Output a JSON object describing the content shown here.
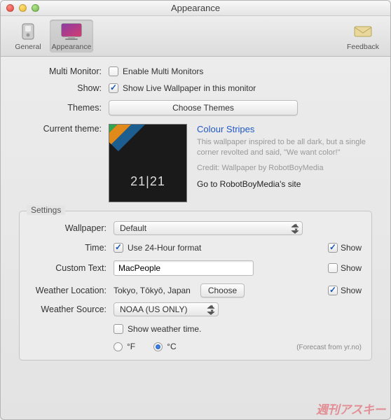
{
  "window": {
    "title": "Appearance"
  },
  "toolbar": {
    "items": [
      {
        "label": "General"
      },
      {
        "label": "Appearance"
      },
      {
        "label": "Feedback"
      }
    ]
  },
  "content": {
    "multiMonitorLabel": "Multi Monitor:",
    "enableMultiMonitors": "Enable Multi Monitors",
    "showLabel": "Show:",
    "showLive": "Show Live Wallpaper in this monitor",
    "themesLabel": "Themes:",
    "chooseThemes": "Choose Themes",
    "currentThemeLabel": "Current theme:",
    "themePreviewTime": "21|21",
    "themeName": "Colour Stripes",
    "themeDesc": "This wallpaper inspired to be all dark, but a single corner revolted and said, \"We want color!\"",
    "themeCredit": "Credit: Wallpaper by RobotBoyMedia",
    "themeLink": "Go to RobotBoyMedia's site"
  },
  "settings": {
    "groupTitle": "Settings",
    "wallpaperLabel": "Wallpaper:",
    "wallpaperValue": "Default",
    "timeLabel": "Time:",
    "use24h": "Use 24-Hour format",
    "showText": "Show",
    "customTextLabel": "Custom Text:",
    "customTextValue": "MacPeople",
    "weatherLocLabel": "Weather Location:",
    "weatherLocValue": "Tokyo, Tōkyō, Japan",
    "chooseBtn": "Choose",
    "weatherSourceLabel": "Weather Source:",
    "weatherSourceValue": "NOAA (US ONLY)",
    "showWeatherTime": "Show weather time.",
    "fahrenheit": "°F",
    "celsius": "°C",
    "forecastNote": "(Forecast from yr.no)"
  },
  "watermark": "週刊アスキー"
}
